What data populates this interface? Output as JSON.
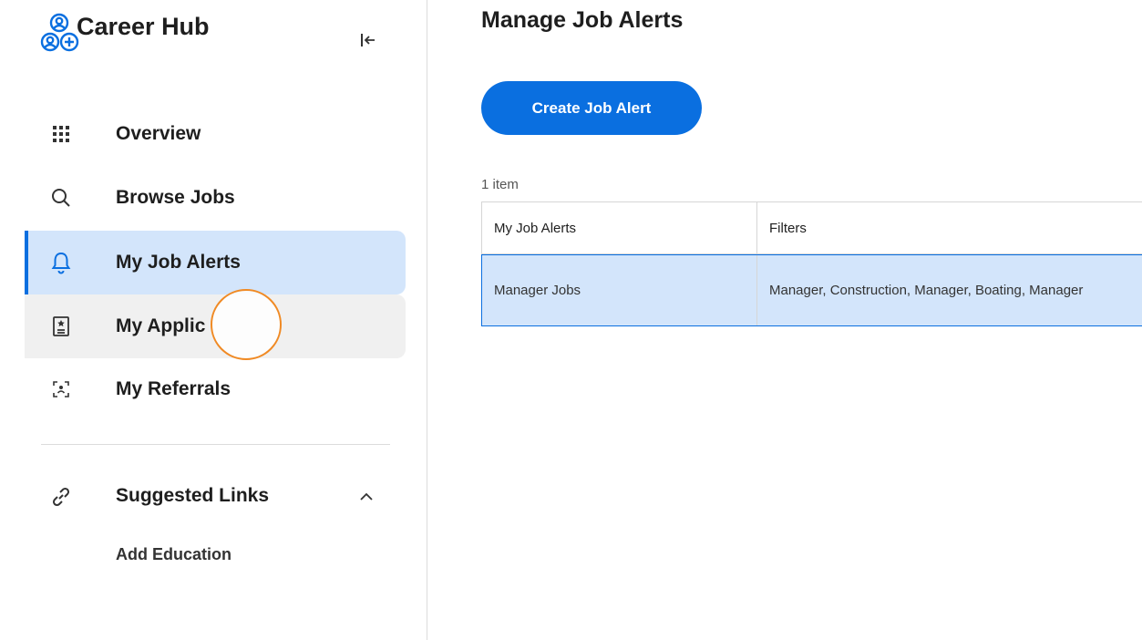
{
  "sidebar": {
    "title": "Career Hub",
    "nav": [
      {
        "label": "Overview",
        "icon": "grid-icon"
      },
      {
        "label": "Browse Jobs",
        "icon": "search-icon"
      },
      {
        "label": "My Job Alerts",
        "icon": "bell-icon",
        "active": true
      },
      {
        "label": "My Applic",
        "icon": "document-icon"
      },
      {
        "label": "My Referrals",
        "icon": "referral-icon"
      }
    ],
    "suggested_links": {
      "label": "Suggested Links",
      "items": [
        "Add Education"
      ]
    }
  },
  "main": {
    "title": "Manage Job Alerts",
    "create_button": "Create Job Alert",
    "item_count": "1 item",
    "table": {
      "columns": [
        "My Job Alerts",
        "Filters"
      ],
      "rows": [
        [
          "Manager Jobs",
          "Manager, Construction, Manager, Boating, Manager"
        ]
      ]
    }
  },
  "colors": {
    "accent": "#0a6fe0",
    "active_bg": "#d3e5fb",
    "cursor_ring": "#f08a24"
  }
}
